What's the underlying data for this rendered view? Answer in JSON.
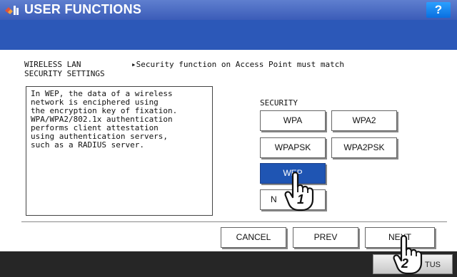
{
  "title_bar": {
    "title": "USER FUNCTIONS",
    "help_label": "?"
  },
  "header": {
    "left_line1": "WIRELESS LAN",
    "left_line2": "SECURITY SETTINGS",
    "notice": "▸Security function on Access Point must match"
  },
  "description": "In WEP, the data of a wireless\nnetwork is enciphered using\nthe encryption key of fixation.\nWPA/WPA2/802.1x authentication\nperforms client attestation\nusing authentication servers,\nsuch as a RADIUS server.",
  "security": {
    "label": "SECURITY",
    "options": [
      "WPA",
      "WPA2",
      "WPAPSK",
      "WPA2PSK",
      "WEP",
      "N"
    ],
    "selected": "WEP"
  },
  "nav": {
    "cancel": "CANCEL",
    "prev": "PREV",
    "next": "NEXT"
  },
  "footer": {
    "status_label": "TUS"
  },
  "annotations": {
    "step1": "1",
    "step2": "2"
  },
  "colors": {
    "accent": "#2c58b8",
    "selected": "#1f55b3",
    "footer": "#262626"
  }
}
